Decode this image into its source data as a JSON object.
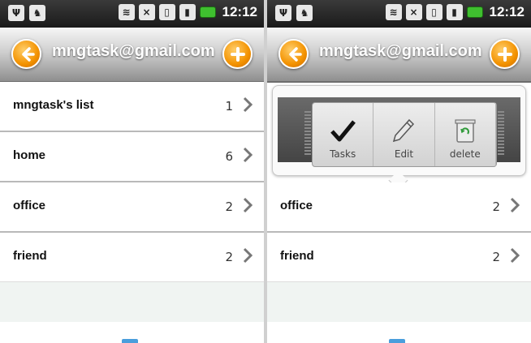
{
  "status_bar": {
    "time": "12:12"
  },
  "header": {
    "account": "mngtask@gmail.com",
    "back_icon": "arrow-left-icon",
    "add_icon": "plus-icon"
  },
  "lists": [
    {
      "name": "mngtask's list",
      "count": "1"
    },
    {
      "name": "home",
      "count": "6"
    },
    {
      "name": "office",
      "count": "2"
    },
    {
      "name": "friend",
      "count": "2"
    }
  ],
  "quick_actions": [
    {
      "label": "Tasks",
      "icon": "checkmark-icon"
    },
    {
      "label": "Edit",
      "icon": "pencil-icon"
    },
    {
      "label": "delete",
      "icon": "trash-icon"
    }
  ],
  "colors": {
    "accent": "#f39200",
    "title_text": "#ffffff"
  }
}
